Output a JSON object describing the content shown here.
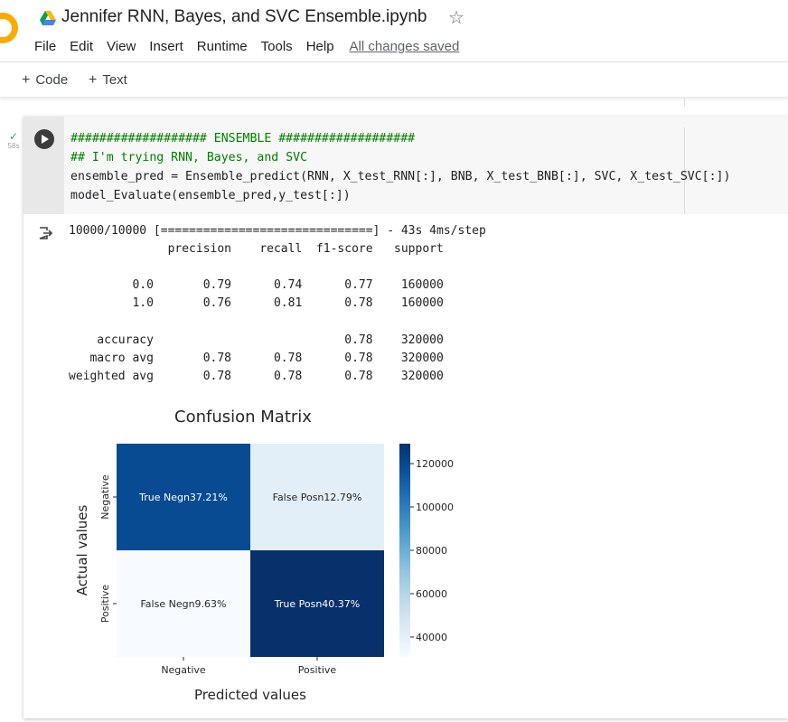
{
  "header": {
    "title": "Jennifer RNN, Bayes, and SVC Ensemble.ipynb",
    "menu": [
      "File",
      "Edit",
      "View",
      "Insert",
      "Runtime",
      "Tools",
      "Help"
    ],
    "saved_status": "All changes saved"
  },
  "toolbar": {
    "code_label": "Code",
    "text_label": "Text"
  },
  "cell": {
    "status_time": "58s",
    "code_lines": [
      "################### ENSEMBLE ###################",
      "## I'm trying RNN, Bayes, and SVC",
      "ensemble_pred = Ensemble_predict(RNN, X_test_RNN[:], BNB, X_test_BNB[:], SVC, X_test_SVC[:])",
      "model_Evaluate(ensemble_pred,y_test[:])"
    ]
  },
  "output": {
    "progress_line": "10000/10000 [==============================] - 43s 4ms/step",
    "report_lines": [
      "              precision    recall  f1-score   support",
      "",
      "         0.0       0.79      0.74      0.77    160000",
      "         1.0       0.76      0.81      0.78    160000",
      "",
      "    accuracy                           0.78    320000",
      "   macro avg       0.78      0.78      0.78    320000",
      "weighted avg       0.78      0.78      0.78    320000"
    ]
  },
  "chart_data": {
    "type": "heatmap",
    "title": "Confusion Matrix",
    "xlabel": "Predicted values",
    "ylabel": "Actual values",
    "x_categories": [
      "Negative",
      "Positive"
    ],
    "y_categories": [
      "Negative",
      "Positive"
    ],
    "cell_labels": [
      [
        "True Negn37.21%",
        "False Posn12.79%"
      ],
      [
        "False Negn9.63%",
        "True Posn40.37%"
      ]
    ],
    "values": [
      [
        119072,
        40928
      ],
      [
        30816,
        129184
      ]
    ],
    "colorbar": {
      "min": 30816,
      "max": 129184,
      "ticks": [
        40000,
        60000,
        80000,
        100000,
        120000
      ],
      "colormap": "Blues"
    }
  }
}
